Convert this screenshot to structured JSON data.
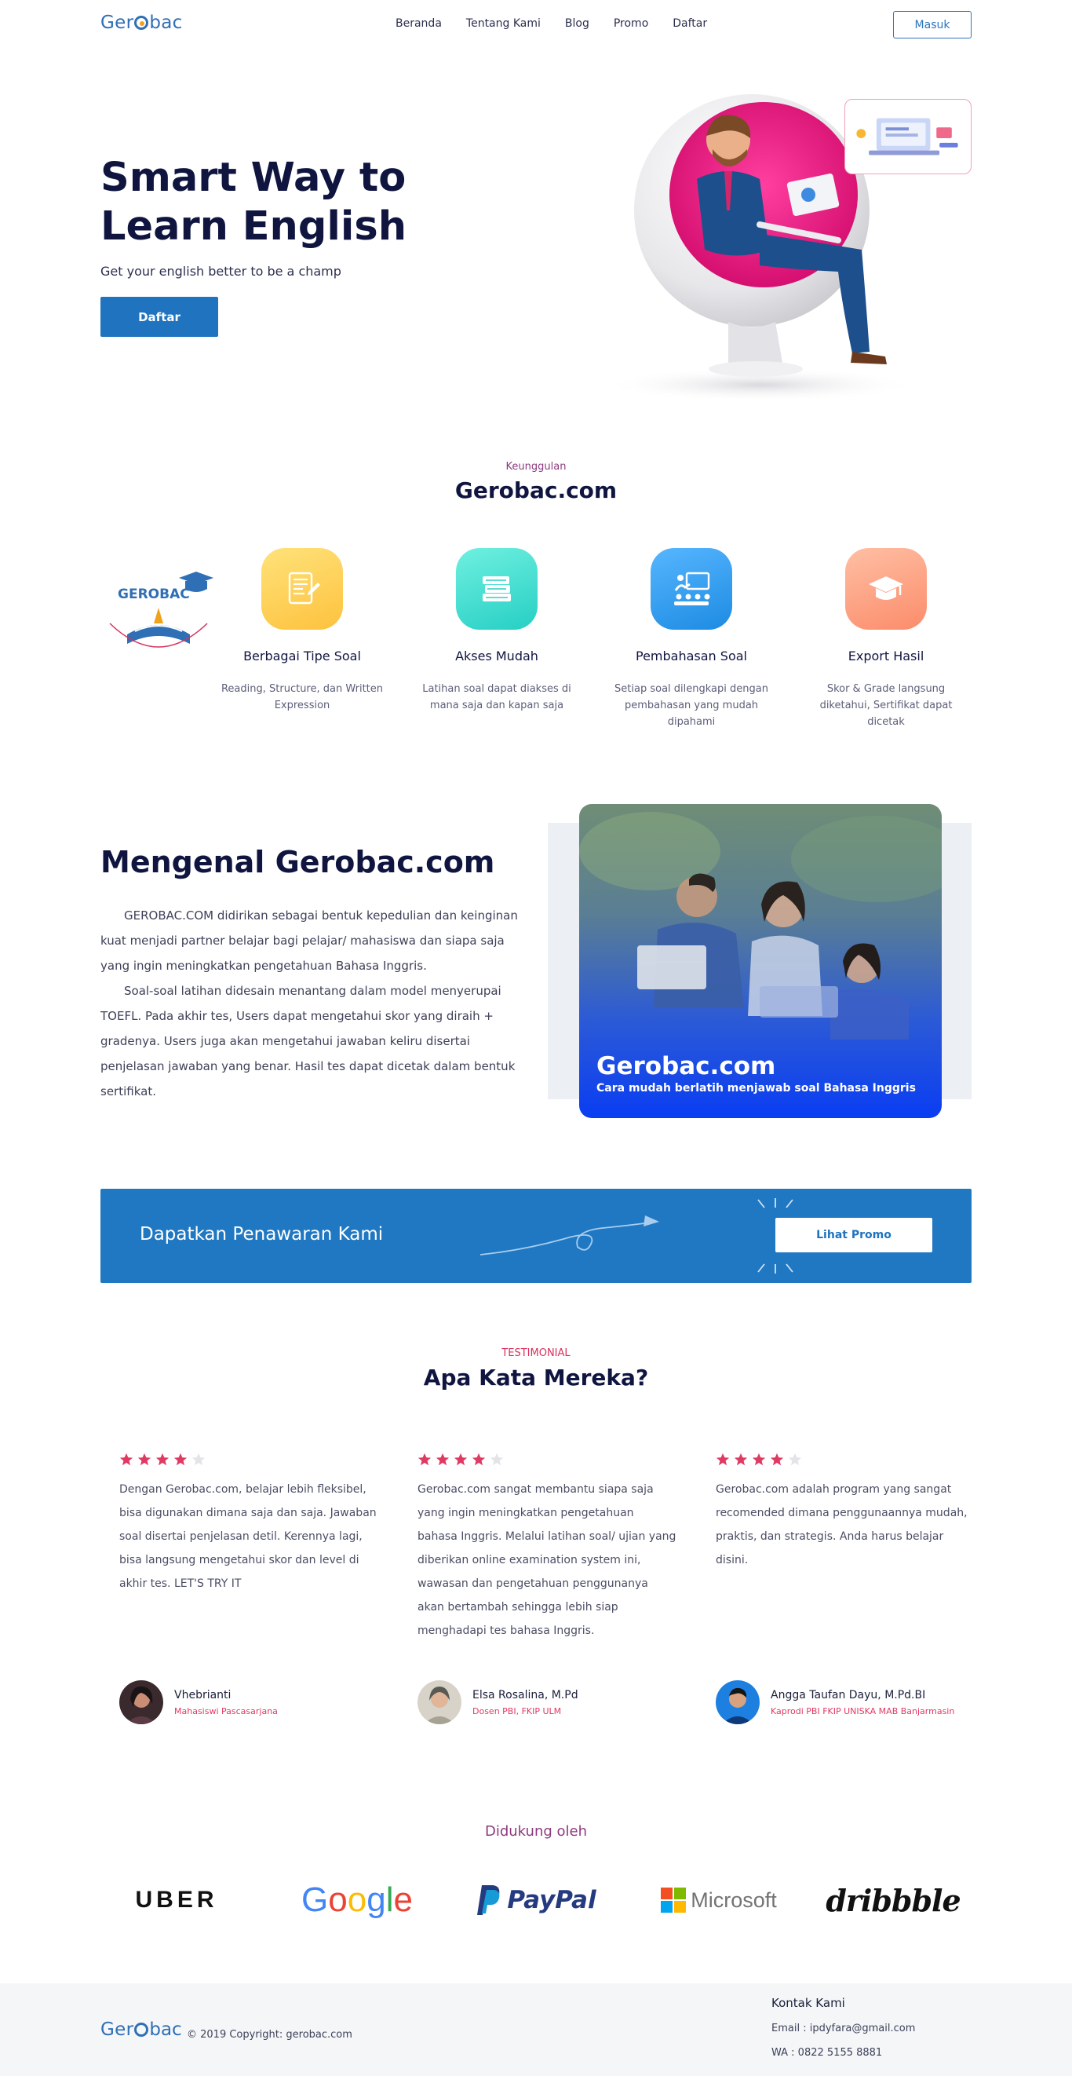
{
  "nav": {
    "logo": "Gerobac",
    "items": [
      "Beranda",
      "Tentang Kami",
      "Blog",
      "Promo",
      "Daftar"
    ],
    "login_label": "Masuk"
  },
  "hero": {
    "title": "Smart Way to Learn English",
    "subtitle": "Get your english better to be a champ",
    "cta_label": "Daftar"
  },
  "features": {
    "eyebrow": "Keunggulan",
    "title": "Gerobac.com",
    "items": [
      {
        "title": "Berbagai Tipe Soal",
        "desc": "Reading, Structure, dan Written Expression",
        "icon": "test-paper-icon",
        "color": "#fdd25a"
      },
      {
        "title": "Akses Mudah",
        "desc": "Latihan soal dapat diakses di mana saja dan kapan saja",
        "icon": "books-stack-icon",
        "color": "#3fded2"
      },
      {
        "title": "Pembahasan Soal",
        "desc": "Setiap soal dilengkapi dengan pembahasan yang mudah dipahami",
        "icon": "classroom-icon",
        "color": "#2f9bec"
      },
      {
        "title": "Export Hasil",
        "desc": "Skor & Grade langsung diketahui, Sertifikat dapat dicetak",
        "icon": "graduation-cap-icon",
        "color": "#fd9e80"
      }
    ]
  },
  "about": {
    "title": "Mengenal Gerobac.com",
    "p1": "GEROBAC.COM didirikan sebagai bentuk kepedulian dan keinginan kuat menjadi partner belajar bagi pelajar/ mahasiswa dan siapa saja yang ingin meningkatkan pengetahuan Bahasa Inggris.",
    "p2": "Soal-soal latihan didesain menantang dalam model menyerupai TOEFL. Pada akhir tes, Users dapat mengetahui skor yang diraih + gradenya. Users juga akan mengetahui jawaban keliru disertai penjelasan jawaban yang benar. Hasil tes dapat dicetak dalam bentuk sertifikat.",
    "image_title": "Gerobac.com",
    "image_caption": "Cara mudah berlatih menjawab soal Bahasa Inggris"
  },
  "promo": {
    "text": "Dapatkan Penawaran Kami",
    "button_label": "Lihat Promo"
  },
  "testimonials": {
    "eyebrow": "TESTIMONIAL",
    "title": "Apa Kata Mereka?",
    "items": [
      {
        "rating": 4,
        "quote": "Dengan Gerobac.com, belajar lebih fleksibel, bisa digunakan dimana saja dan saja. Jawaban soal disertai penjelasan detil. Kerennya lagi, bisa langsung mengetahui skor dan level di akhir tes. LET'S TRY IT",
        "name": "Vhebrianti",
        "role": "Mahasiswi Pascasarjana"
      },
      {
        "rating": 4,
        "quote": "Gerobac.com sangat membantu siapa saja yang ingin meningkatkan pengetahuan bahasa Inggris. Melalui latihan soal/ ujian yang diberikan online examination system ini, wawasan dan pengetahuan penggunanya akan bertambah sehingga lebih siap menghadapi tes bahasa Inggris.",
        "name": "Elsa Rosalina, M.Pd",
        "role": "Dosen PBI, FKIP ULM"
      },
      {
        "rating": 4,
        "quote": "Gerobac.com adalah program yang sangat recomended dimana penggunaannya mudah, praktis, dan strategis. Anda harus belajar disini.",
        "name": "Angga Taufan Dayu, M.Pd.BI",
        "role": "Kaprodi PBI FKIP UNISKA MAB Banjarmasin"
      }
    ]
  },
  "sponsors": {
    "title": "Didukung oleh",
    "brands": [
      "UBER",
      "Google",
      "PayPal",
      "Microsoft",
      "dribbble"
    ]
  },
  "footer": {
    "logo": "Gerobac",
    "copyright": "© 2019 Copyright: gerobac.com",
    "contact_title": "Kontak Kami",
    "email": "Email : ipdyfara@gmail.com",
    "wa": "WA : 0822 5155 8881"
  },
  "colors": {
    "primary": "#1f73bf",
    "heading": "#101540",
    "accent": "#8d3a7e",
    "star": "#e03a63"
  }
}
